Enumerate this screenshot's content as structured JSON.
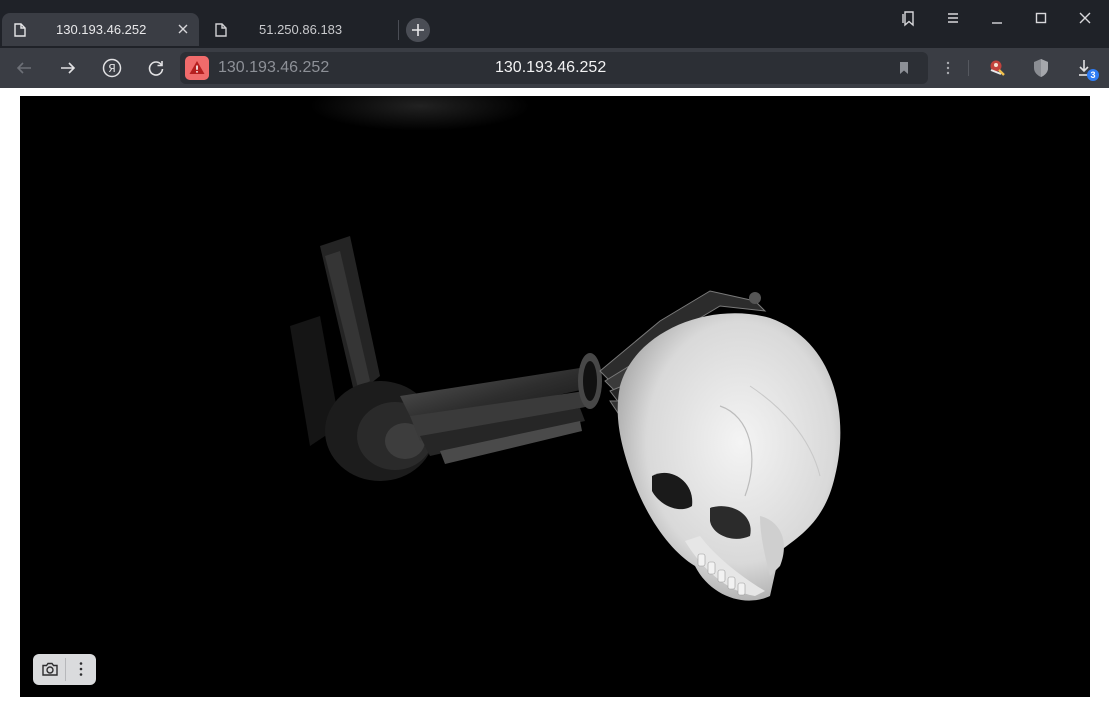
{
  "browser": {
    "tabs": [
      {
        "title": "130.193.46.252",
        "active": true,
        "icon": "document-icon"
      },
      {
        "title": "51.250.86.183",
        "active": false,
        "icon": "document-icon"
      }
    ],
    "address_bar": {
      "security_icon": "warning-icon",
      "url_display": "130.193.46.252",
      "page_title": "130.193.46.252"
    },
    "toolbar_icons": [
      "back-arrow-icon",
      "forward-arrow-icon",
      "yandex-icon",
      "reload-icon",
      "bookmark-icon",
      "more-icon",
      "extension-icon",
      "shield-icon",
      "download-icon"
    ],
    "downloads_count": "3",
    "window_controls": [
      "collections-icon",
      "menu-icon",
      "minimize-icon",
      "maximize-icon",
      "close-icon"
    ]
  },
  "content": {
    "image_subject": "robotic-hand-skull-image",
    "overlay_controls": [
      "camera-icon",
      "more-vertical-icon"
    ]
  },
  "colors": {
    "tabbar": "#1f2228",
    "toolbar": "#3a3d44",
    "warning": "#f06b6b",
    "badge": "#2f7df6"
  }
}
